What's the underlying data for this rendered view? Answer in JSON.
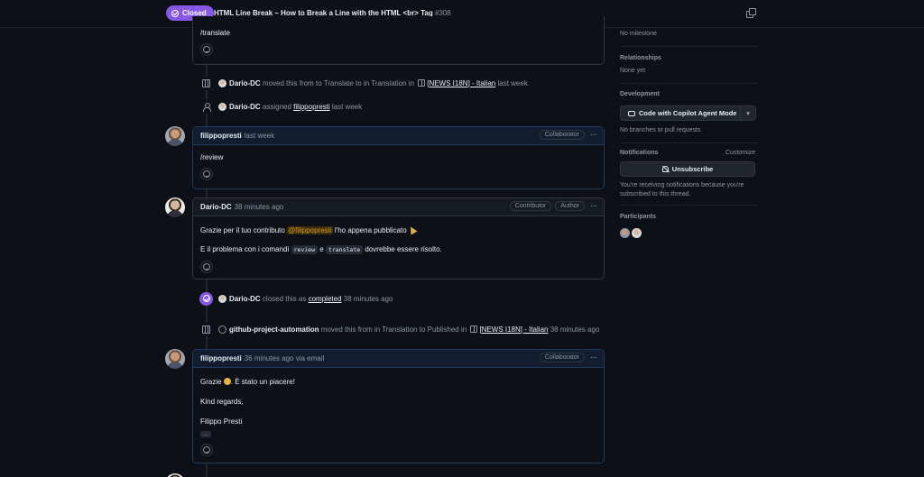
{
  "header": {
    "state": "Closed",
    "title": "HTML Line Break – How to Break a Line with the HTML <br> Tag",
    "number": "#308"
  },
  "top_comment": {
    "text": "/translate"
  },
  "events": {
    "moved_1": {
      "actor": "Dario-DC",
      "text_a": "moved this from to Translate to in Translation in",
      "project": "[NEWS I18N] - Italian",
      "time": "last week"
    },
    "assigned": {
      "actor": "Dario-DC",
      "text_a": "assigned",
      "target": "filippopresti",
      "time": "last week"
    },
    "closed": {
      "actor": "Dario-DC",
      "text_a": "closed this as",
      "link": "completed",
      "time": "38 minutes ago"
    },
    "moved_2": {
      "actor": "github-project-automation",
      "text_a": "moved this from in Translation to Published in",
      "project": "[NEWS I18N] - Italian",
      "time": "38 minutes ago"
    }
  },
  "comments": {
    "review": {
      "author": "filippopresti",
      "time": "last week",
      "badge": "Collaborator",
      "body": "/review"
    },
    "dario": {
      "author": "Dario-DC",
      "time": "38 minutes ago",
      "badge1": "Contributor",
      "badge2": "Author",
      "line1_a": "Grazie per il tuo contributo",
      "line1_mention": "@filippopresti",
      "line1_b": "l'ho appena pubblicato",
      "line2_a": "E il problema con i comandi",
      "code1": "review",
      "line2_and": "e",
      "code2": "translate",
      "line2_b": "dovrebbe essere risolto."
    },
    "email": {
      "author": "filippopresti",
      "time": "36 minutes ago via email",
      "badge": "Collaborator",
      "line1_a": "Grazie",
      "line1_b": ". È stato un piacere!",
      "line2": "Kind regards,",
      "line3": "Filippo Presti",
      "ellipsis": "..."
    }
  },
  "sidebar": {
    "milestone_value": "No milestone",
    "relationships_title": "Relationships",
    "relationships_value": "None yet",
    "development_title": "Development",
    "copilot_button": "Code with Copilot Agent Mode",
    "development_value": "No branches or pull requests",
    "notifications_title": "Notifications",
    "customize": "Customize",
    "unsubscribe_button": "Unsubscribe",
    "notifications_note": "You're receiving notifications because you're subscribed to this thread.",
    "participants_title": "Participants"
  },
  "icons": [
    "check-circle-icon",
    "copy-icon",
    "project-table-icon",
    "person-icon",
    "smiley-icon",
    "kebab-icon",
    "bell-slash-icon",
    "copilot-icon",
    "github-icon"
  ],
  "colors": {
    "background": "#0d1117",
    "closed_purple": "#8957e5",
    "mention": "#d29922",
    "muted": "#8d96a0"
  }
}
